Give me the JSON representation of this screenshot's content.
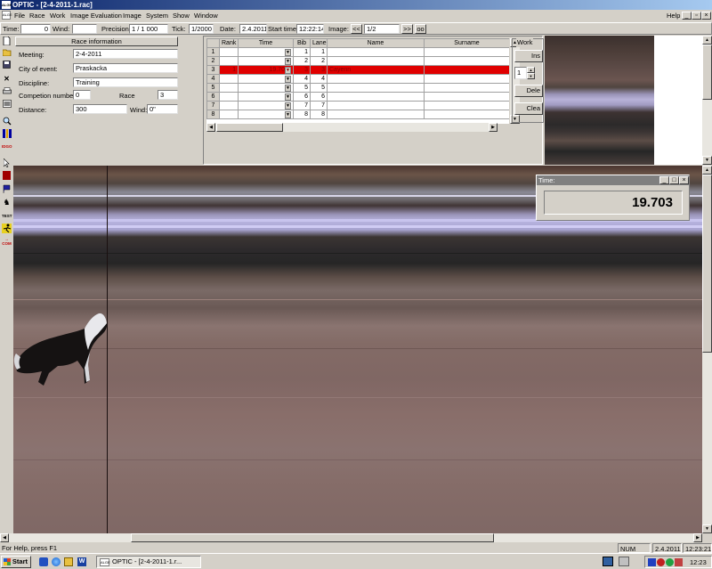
{
  "window": {
    "title": "OPTIC - [2-4-2011-1.rac]",
    "app_icon": "ALGE"
  },
  "menu": {
    "items": [
      "File",
      "Race",
      "Work",
      "Image Evaluation",
      "Image",
      "System",
      "Show",
      "Window"
    ],
    "help": "Help"
  },
  "toolbar": {
    "time_label": "Time:",
    "time_value": "0",
    "wind_label": "Wind:",
    "wind_value": "",
    "precision_label": "Precision:",
    "precision_value": "1 / 1 000",
    "tick_label": "Tick:",
    "tick_value": "1/2000",
    "date_label": "Date:",
    "date_value": "2.4.2011",
    "start_time_label": "Start time",
    "start_time_value": "12:22:14",
    "image_label": "Image:",
    "image_prev": "<<",
    "image_value": "1/2",
    "image_next": ">>",
    "image_extra": "oo"
  },
  "race_info": {
    "title": "Race information",
    "meeting_label": "Meeting:",
    "meeting_value": "2-4-2011",
    "city_label": "City of event:",
    "city_value": "Praskacka",
    "discipline_label": "Discipline:",
    "discipline_value": "Training",
    "competition_label": "Competion number:",
    "competition_value": "0",
    "race_label": "Race",
    "race_value": "3",
    "distance_label": "Distance:",
    "distance_value": "300",
    "wind_label": "Wind:",
    "wind_value": "0\""
  },
  "results_table": {
    "columns": [
      "Rank",
      "Time",
      "Bib",
      "Lane",
      "Name",
      "Surname"
    ],
    "rows": [
      {
        "idx": "1",
        "rank": "",
        "time": "",
        "bib": "1",
        "lane": "1",
        "name": "",
        "surname": ""
      },
      {
        "idx": "2",
        "rank": "",
        "time": "",
        "bib": "2",
        "lane": "2",
        "name": "",
        "surname": ""
      },
      {
        "idx": "3",
        "rank": "1",
        "time": "19.70",
        "bib": "3",
        "lane": "3",
        "name": "Cayenn",
        "surname": ""
      },
      {
        "idx": "4",
        "rank": "",
        "time": "",
        "bib": "4",
        "lane": "4",
        "name": "",
        "surname": ""
      },
      {
        "idx": "5",
        "rank": "",
        "time": "",
        "bib": "5",
        "lane": "5",
        "name": "",
        "surname": ""
      },
      {
        "idx": "6",
        "rank": "",
        "time": "",
        "bib": "6",
        "lane": "6",
        "name": "",
        "surname": ""
      },
      {
        "idx": "7",
        "rank": "",
        "time": "",
        "bib": "7",
        "lane": "7",
        "name": "",
        "surname": ""
      },
      {
        "idx": "8",
        "rank": "",
        "time": "",
        "bib": "8",
        "lane": "8",
        "name": "",
        "surname": ""
      }
    ]
  },
  "work_panel": {
    "title": "Work",
    "insert": "Ins",
    "spin_value": "1",
    "delete": "Dele",
    "clear": "Clea"
  },
  "time_popup": {
    "title": "Time:",
    "value": "19.703"
  },
  "statusbar": {
    "help_text": "For Help, press F1",
    "num": "NUM",
    "date": "2.4.2011",
    "time": "12:23:21"
  },
  "taskbar": {
    "start": "Start",
    "task": "OPTIC - [2-4-2011-1.r...",
    "clock": "12:23"
  },
  "left_tools": [
    "new-icon",
    "open-icon",
    "save-icon",
    "close-icon",
    "print-icon",
    "preview-icon",
    "zoom-icon",
    "columns-icon",
    "ids-icon",
    "cursor-icon",
    "marker-icon",
    "flag-icon",
    "horse-icon",
    "test-icon",
    "runner-icon",
    "com-icon"
  ],
  "left_tool_labels": {
    "ids": "IDGO",
    "test": "TEST",
    "com": "COM"
  },
  "colors": {
    "highlight_row": "#e00000",
    "title_bar": "#0a246a"
  }
}
